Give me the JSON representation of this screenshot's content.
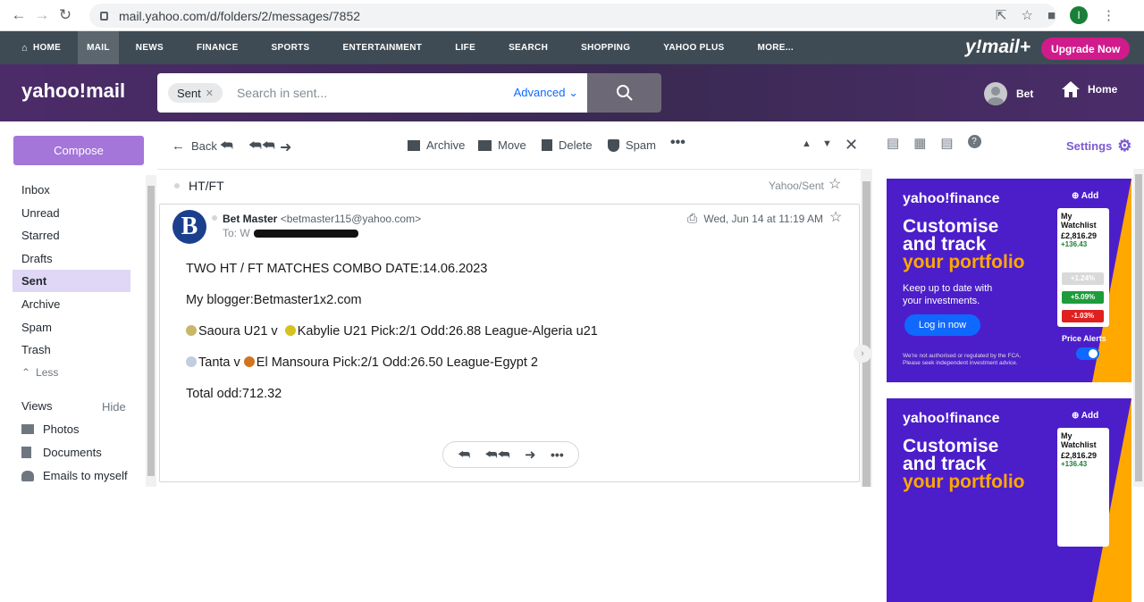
{
  "browser": {
    "url": "mail.yahoo.com/d/folders/2/messages/7852",
    "profile_initial": "I"
  },
  "topnav": {
    "items": [
      "HOME",
      "MAIL",
      "NEWS",
      "FINANCE",
      "SPORTS",
      "ENTERTAINMENT",
      "LIFE",
      "SEARCH",
      "SHOPPING",
      "YAHOO PLUS",
      "MORE..."
    ],
    "brand": "y!mail+",
    "upgrade": "Upgrade Now"
  },
  "header": {
    "logo": "yahoo!mail",
    "search_chip": "Sent",
    "search_placeholder": "Search in sent...",
    "advanced": "Advanced",
    "user_name": "Bet",
    "home": "Home"
  },
  "sidebar": {
    "compose": "Compose",
    "folders": [
      "Inbox",
      "Unread",
      "Starred",
      "Drafts",
      "Sent",
      "Archive",
      "Spam",
      "Trash"
    ],
    "selected": "Sent",
    "less": "Less",
    "views_label": "Views",
    "hide": "Hide",
    "views": [
      "Photos",
      "Documents",
      "Emails to myself"
    ]
  },
  "toolbar": {
    "back": "Back",
    "archive": "Archive",
    "move": "Move",
    "delete": "Delete",
    "spam": "Spam"
  },
  "message": {
    "subject": "HT/FT",
    "folder_label": "Yahoo/Sent",
    "avatar_letter": "B",
    "from_name": "Bet Master",
    "from_email": "<betmaster115@yahoo.com>",
    "to_label": "To:",
    "to_visible": "W",
    "date": "Wed, Jun 14 at 11:19 AM",
    "body": {
      "line1": "TWO HT / FT MATCHES COMBO DATE:14.06.2023",
      "line2": "My blogger:Betmaster1x2.com",
      "line3_a": "Saoura U21 v ",
      "line3_b": "Kabylie U21 Pick:2/1 Odd:26.88 League-Algeria u21",
      "line4_a": "Tanta v ",
      "line4_b": "El Mansoura Pick:2/1 Odd:26.50 League-Egypt 2",
      "line5": "Total odd:712.32"
    }
  },
  "right_panel": {
    "settings": "Settings",
    "ads": [
      {
        "brand": "yahoo!finance",
        "add": "Add",
        "headline_1": "Customise",
        "headline_2": "and track",
        "headline_3": "your portfolio",
        "sub_1": "Keep up to date with",
        "sub_2": "your investments.",
        "login": "Log in now",
        "fine_1": "We're not authorised or regulated by the FCA.",
        "fine_2": "Please seek independent investment advice.",
        "watchlist_title_1": "My",
        "watchlist_title_2": "Watchlist",
        "value": "£2,816.29",
        "change": "+136.43",
        "pills": [
          "+1.24%",
          "+5.09%",
          "-1.03%"
        ],
        "price_alerts": "Price Alerts"
      }
    ]
  },
  "colors": {
    "accent": "#7c5bd1",
    "compose": "#a476d9",
    "selected_folder": "#e0d6f5",
    "topnav_bg": "#3f4b54",
    "header_bg": "#3a2a52",
    "upgrade": "#d11a8c",
    "ad_bg": "#4c1ec9",
    "ad_yellow": "#ffa800"
  }
}
